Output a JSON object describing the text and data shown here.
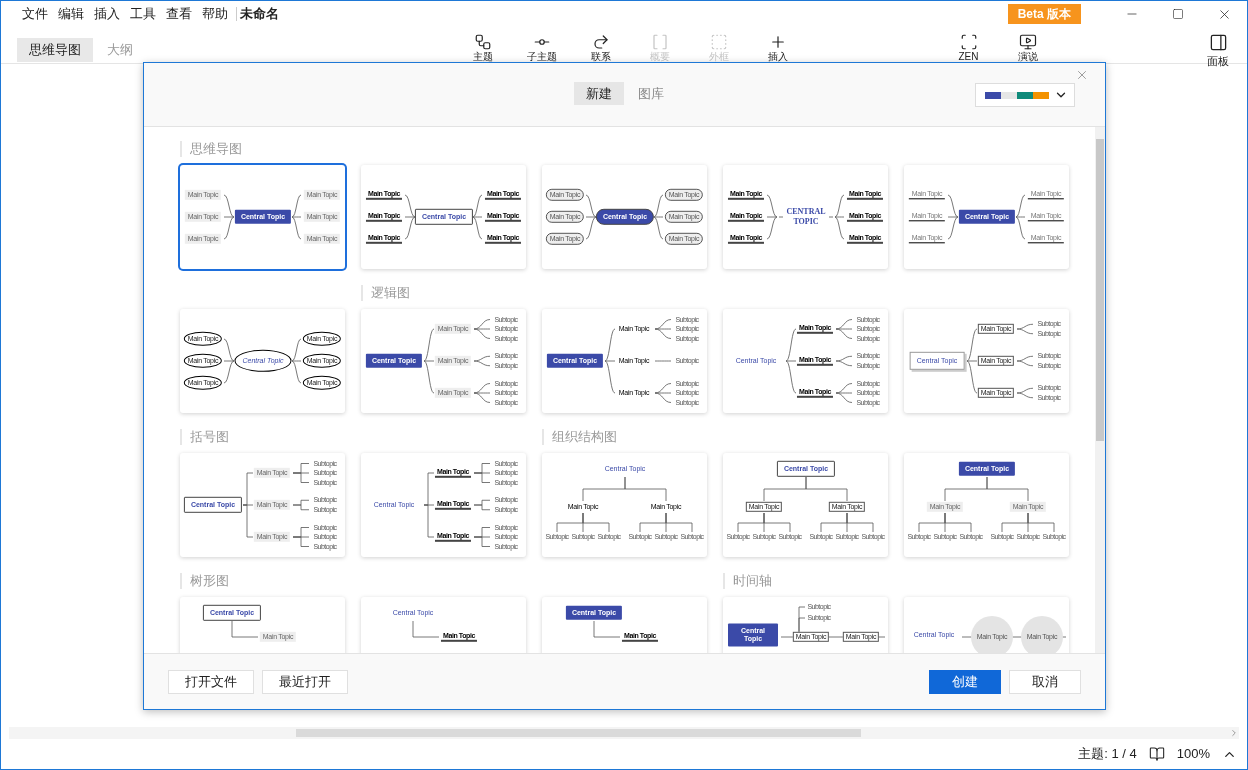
{
  "menu": [
    {
      "label": "文件"
    },
    {
      "label": "编辑"
    },
    {
      "label": "插入"
    },
    {
      "label": "工具"
    },
    {
      "label": "查看"
    },
    {
      "label": "帮助"
    }
  ],
  "document_title": "未命名",
  "beta_badge": "Beta 版本",
  "view_tabs": [
    {
      "label": "思维导图",
      "selected": true
    },
    {
      "label": "大纲",
      "selected": false
    }
  ],
  "toolbar": [
    {
      "kind": "topic",
      "label": "主题",
      "disabled": false
    },
    {
      "kind": "subtopic",
      "label": "子主题",
      "disabled": false
    },
    {
      "kind": "relation",
      "label": "联系",
      "disabled": false
    },
    {
      "kind": "summary",
      "label": "概要",
      "disabled": true
    },
    {
      "kind": "boundary",
      "label": "外框",
      "disabled": true
    },
    {
      "kind": "insert",
      "label": "插入",
      "disabled": false
    }
  ],
  "right_tools": [
    {
      "kind": "zen",
      "label": "ZEN"
    },
    {
      "kind": "present",
      "label": "演说"
    }
  ],
  "panel_button": {
    "label": "面板"
  },
  "dialog": {
    "tabs": [
      {
        "label": "新建",
        "selected": true
      },
      {
        "label": "图库",
        "selected": false
      }
    ],
    "theme_swatches": [
      {
        "color": "#3b4aa8"
      },
      {
        "color": "#e6e6e6"
      },
      {
        "color": "#0f8a7a"
      },
      {
        "color": "#f39200"
      }
    ],
    "sections": [
      {
        "title": "思维导图",
        "templates": [
          {
            "kind": "mindmap",
            "selected": true,
            "central": "Central Topic",
            "topics": [
              {
                "label": "Main Topic"
              },
              {
                "label": "Main Topic"
              },
              {
                "label": "Main Topic"
              },
              {
                "label": "Main Topic"
              },
              {
                "label": "Main Topic"
              },
              {
                "label": "Main Topic"
              }
            ]
          },
          {
            "kind": "mindmap",
            "selected": false,
            "central": "Central Topic",
            "topics": [
              {
                "label": "Main Topic"
              },
              {
                "label": "Main Topic"
              },
              {
                "label": "Main Topic"
              },
              {
                "label": "Main Topic"
              },
              {
                "label": "Main Topic"
              },
              {
                "label": "Main Topic"
              }
            ]
          },
          {
            "kind": "mindmap",
            "selected": false,
            "central": "Central Topic",
            "topics": [
              {
                "label": "Main Topic"
              },
              {
                "label": "Main Topic"
              },
              {
                "label": "Main Topic"
              },
              {
                "label": "Main Topic"
              },
              {
                "label": "Main Topic"
              },
              {
                "label": "Main Topic"
              }
            ]
          },
          {
            "kind": "mindmap",
            "selected": false,
            "central": "CENTRAL TOPIC",
            "topics": [
              {
                "label": "Main Topic"
              },
              {
                "label": "Main Topic"
              },
              {
                "label": "Main Topic"
              },
              {
                "label": "Main Topic"
              },
              {
                "label": "Main Topic"
              },
              {
                "label": "Main Topic"
              }
            ]
          },
          {
            "kind": "mindmap",
            "selected": false,
            "central": "Central Topic",
            "topics": [
              {
                "label": "Main Topic"
              },
              {
                "label": "Main Topic"
              },
              {
                "label": "Main Topic"
              },
              {
                "label": "Main Topic"
              },
              {
                "label": "Main Topic"
              },
              {
                "label": "Main Topic"
              }
            ]
          },
          {
            "kind": "mindmap",
            "selected": false,
            "central": "Central Topic",
            "topics": [
              {
                "label": "Main Topic"
              },
              {
                "label": "Main Topic"
              },
              {
                "label": "Main Topic"
              },
              {
                "label": "Main Topic"
              },
              {
                "label": "Main Topic"
              },
              {
                "label": "Main Topic"
              }
            ]
          }
        ]
      },
      {
        "title": "逻辑图",
        "templates": [
          {
            "kind": "logic",
            "selected": false,
            "central": "Central Topic",
            "topics": [
              {
                "label": "Main Topic",
                "subtopics": [
                  "Subtopic",
                  "Subtopic",
                  "Subtopic"
                ]
              },
              {
                "label": "Main Topic",
                "subtopics": [
                  "Subtopic",
                  "Subtopic"
                ]
              },
              {
                "label": "Main Topic",
                "subtopics": [
                  "Subtopic",
                  "Subtopic",
                  "Subtopic"
                ]
              }
            ]
          },
          {
            "kind": "logic",
            "selected": false,
            "central": "Central Topic",
            "topics": [
              {
                "label": "Main Topic",
                "subtopics": [
                  "Subtopic",
                  "Subtopic",
                  "Subtopic"
                ]
              },
              {
                "label": "Main Topic",
                "subtopics": [
                  "Subtopic"
                ]
              },
              {
                "label": "Main Topic",
                "subtopics": [
                  "Subtopic",
                  "Subtopic",
                  "Subtopic"
                ]
              }
            ]
          },
          {
            "kind": "logic",
            "selected": false,
            "central": "Central Topic",
            "topics": [
              {
                "label": "Main Topic",
                "subtopics": [
                  "Subtopic",
                  "Subtopic",
                  "Subtopic"
                ]
              },
              {
                "label": "Main Topic",
                "subtopics": [
                  "Subtopic",
                  "Subtopic"
                ]
              },
              {
                "label": "Main Topic",
                "subtopics": [
                  "Subtopic",
                  "Subtopic",
                  "Subtopic"
                ]
              }
            ]
          },
          {
            "kind": "logic",
            "selected": false,
            "central": "Central Topic",
            "topics": [
              {
                "label": "Main Topic",
                "subtopics": [
                  "Subtopic",
                  "Subtopic"
                ]
              },
              {
                "label": "Main Topic",
                "subtopics": [
                  "Subtopic",
                  "Subtopic"
                ]
              },
              {
                "label": "Main Topic",
                "subtopics": [
                  "Subtopic",
                  "Subtopic"
                ]
              }
            ]
          }
        ]
      },
      {
        "title": "括号图",
        "templates": [
          {
            "kind": "brace",
            "selected": false,
            "central": "Central Topic",
            "topics": [
              {
                "label": "Main Topic",
                "subtopics": [
                  "Subtopic",
                  "Subtopic",
                  "Subtopic"
                ]
              },
              {
                "label": "Main Topic",
                "subtopics": [
                  "Subtopic",
                  "Subtopic"
                ]
              },
              {
                "label": "Main Topic",
                "subtopics": [
                  "Subtopic",
                  "Subtopic",
                  "Subtopic"
                ]
              }
            ]
          },
          {
            "kind": "brace",
            "selected": false,
            "central": "Central Topic",
            "topics": [
              {
                "label": "Main Topic",
                "subtopics": [
                  "Subtopic",
                  "Subtopic",
                  "Subtopic"
                ]
              },
              {
                "label": "Main Topic",
                "subtopics": [
                  "Subtopic",
                  "Subtopic"
                ]
              },
              {
                "label": "Main Topic",
                "subtopics": [
                  "Subtopic",
                  "Subtopic",
                  "Subtopic"
                ]
              }
            ]
          }
        ]
      },
      {
        "title": "组织结构图",
        "templates": [
          {
            "kind": "org",
            "selected": false,
            "central": "Central Topic",
            "topics": [
              {
                "label": "Main Topic",
                "subtopics": [
                  "Subtopic",
                  "Subtopic",
                  "Subtopic"
                ]
              },
              {
                "label": "Main Topic",
                "subtopics": [
                  "Subtopic",
                  "Subtopic",
                  "Subtopic"
                ]
              }
            ]
          },
          {
            "kind": "org",
            "selected": false,
            "central": "Central Topic",
            "topics": [
              {
                "label": "Main Topic",
                "subtopics": [
                  "Subtopic",
                  "Subtopic",
                  "Subtopic"
                ]
              },
              {
                "label": "Main Topic",
                "subtopics": [
                  "Subtopic",
                  "Subtopic",
                  "Subtopic"
                ]
              }
            ]
          },
          {
            "kind": "org",
            "selected": false,
            "central": "Central Topic",
            "topics": [
              {
                "label": "Main Topic",
                "subtopics": [
                  "Subtopic",
                  "Subtopic",
                  "Subtopic"
                ]
              },
              {
                "label": "Main Topic",
                "subtopics": [
                  "Subtopic",
                  "Subtopic",
                  "Subtopic"
                ]
              }
            ]
          }
        ]
      },
      {
        "title": "树形图",
        "templates": [
          {
            "kind": "tree",
            "selected": false,
            "central": "Central Topic",
            "topics": [
              {
                "label": "Main Topic"
              }
            ]
          },
          {
            "kind": "tree",
            "selected": false,
            "central": "Central Topic",
            "topics": [
              {
                "label": "Main Topic"
              }
            ]
          },
          {
            "kind": "tree",
            "selected": false,
            "central": "Central Topic",
            "topics": [
              {
                "label": "Main Topic"
              }
            ]
          }
        ]
      },
      {
        "title": "时间轴",
        "templates": [
          {
            "kind": "timeline",
            "selected": false,
            "central": "Central Topic",
            "topics": [
              {
                "label": "Main Topic",
                "subtopics": [
                  "Subtopic",
                  "Subtopic"
                ]
              },
              {
                "label": "Main Topic"
              }
            ]
          },
          {
            "kind": "timeline",
            "selected": false,
            "central": "Central Topic",
            "topics": [
              {
                "label": "Main Topic"
              },
              {
                "label": "Main Topic"
              }
            ]
          }
        ]
      }
    ],
    "left_buttons": [
      {
        "label": "打开文件"
      },
      {
        "label": "最近打开"
      }
    ],
    "create_button": {
      "label": "创建"
    },
    "cancel_button": {
      "label": "取消"
    }
  },
  "status_bar": {
    "topic_count": "主题: 1 / 4",
    "zoom": "100%"
  }
}
